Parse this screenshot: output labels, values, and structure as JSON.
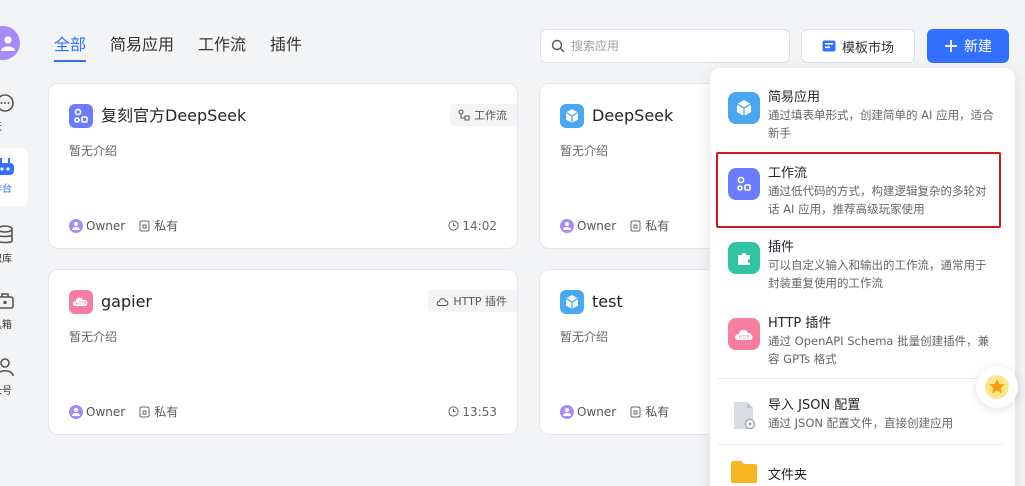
{
  "rail": {
    "items": [
      {
        "label": "天",
        "icon": "chat-icon"
      },
      {
        "label": "作台",
        "icon": "robot-icon"
      },
      {
        "label": "识库",
        "icon": "database-icon"
      },
      {
        "label": "具箱",
        "icon": "toolbox-icon"
      },
      {
        "label": "长号",
        "icon": "user-icon"
      }
    ]
  },
  "tabs": [
    "全部",
    "简易应用",
    "工作流",
    "插件"
  ],
  "search": {
    "placeholder": "搜索应用"
  },
  "toolbar": {
    "template_label": "模板市场",
    "new_label": "新建"
  },
  "cards": [
    {
      "title": "复刻官方DeepSeek",
      "desc": "暂无介绍",
      "badge": "工作流",
      "owner": "Owner",
      "privacy": "私有",
      "time": "14:02"
    },
    {
      "title": "DeepSeek",
      "desc": "暂无介绍",
      "owner": "Owner",
      "privacy": "私有"
    },
    {
      "title": "gapier",
      "desc": "暂无介绍",
      "badge": "HTTP 插件",
      "owner": "Owner",
      "privacy": "私有",
      "time": "13:53"
    },
    {
      "title": "test",
      "desc": "暂无介绍",
      "owner": "Owner",
      "privacy": "私有"
    }
  ],
  "menu": {
    "items": [
      {
        "title": "简易应用",
        "desc": "通过填表单形式，创建简单的 AI 应用，适合新手"
      },
      {
        "title": "工作流",
        "desc": "通过低代码的方式，构建逻辑复杂的多轮对话 AI 应用，推荐高级玩家使用"
      },
      {
        "title": "插件",
        "desc": "可以自定义输入和输出的工作流，通常用于封装重复使用的工作流"
      },
      {
        "title": "HTTP 插件",
        "desc": "通过 OpenAPI Schema 批量创建插件，兼容 GPTs 格式"
      },
      {
        "title": "导入 JSON 配置",
        "desc": "通过 JSON 配置文件，直接创建应用"
      },
      {
        "title": "文件夹",
        "desc": ""
      }
    ]
  },
  "colors": {
    "primary": "#3370ff",
    "highlight_border": "#d0191f"
  }
}
